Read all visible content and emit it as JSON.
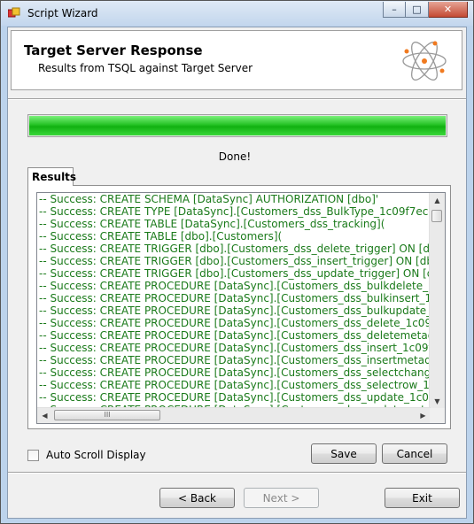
{
  "window": {
    "title": "Script Wizard",
    "controls": {
      "minimize": "–",
      "maximize": "□",
      "close": "✕"
    }
  },
  "header": {
    "title": "Target Server Response",
    "subtitle": "Results from TSQL against Target Server",
    "logo_icon": "atom-icon"
  },
  "progress": {
    "value": 1.0,
    "color": "#22c222"
  },
  "status": "Done!",
  "results_tab": {
    "label": "Results"
  },
  "results": {
    "text_color": "#1a7a1a",
    "lines": [
      "-- Success: CREATE SCHEMA [DataSync] AUTHORIZATION [dbo]'",
      "-- Success: CREATE TYPE [DataSync].[Customers_dss_BulkType_1c09f7ec-183",
      "-- Success: CREATE TABLE [DataSync].[Customers_dss_tracking](",
      "-- Success: CREATE TABLE [dbo].[Customers](",
      "-- Success: CREATE TRIGGER [dbo].[Customers_dss_delete_trigger] ON [dbo].",
      "-- Success: CREATE TRIGGER [dbo].[Customers_dss_insert_trigger] ON [dbo].[",
      "-- Success: CREATE TRIGGER [dbo].[Customers_dss_update_trigger] ON [dbo]",
      "-- Success: CREATE PROCEDURE [DataSync].[Customers_dss_bulkdelete_1c09f",
      "-- Success: CREATE PROCEDURE [DataSync].[Customers_dss_bulkinsert_1c09f7",
      "-- Success: CREATE PROCEDURE [DataSync].[Customers_dss_bulkupdate_1c09",
      "-- Success: CREATE PROCEDURE [DataSync].[Customers_dss_delete_1c09f7ec-",
      "-- Success: CREATE PROCEDURE [DataSync].[Customers_dss_deletemetadata]",
      "-- Success: CREATE PROCEDURE [DataSync].[Customers_dss_insert_1c09f7ec-1",
      "-- Success: CREATE PROCEDURE [DataSync].[Customers_dss_insertmetadata]",
      "-- Success: CREATE PROCEDURE [DataSync].[Customers_dss_selectchanges_1c",
      "-- Success: CREATE PROCEDURE [DataSync].[Customers_dss_selectrow_1c09f7",
      "-- Success: CREATE PROCEDURE [DataSync].[Customers_dss_update_1c09f7ec-",
      "-- Success: CREATE PROCEDURE [DataSync].[Customers_dss_updatemetadata]"
    ],
    "scroll": {
      "up": "▲",
      "down": "▼",
      "left": "◀",
      "right": "▶",
      "grip": "III"
    }
  },
  "auto_scroll": {
    "label": "Auto Scroll Display",
    "checked": false
  },
  "buttons": {
    "save": "Save",
    "cancel": "Cancel",
    "back": "< Back",
    "next": "Next >",
    "exit": "Exit"
  }
}
